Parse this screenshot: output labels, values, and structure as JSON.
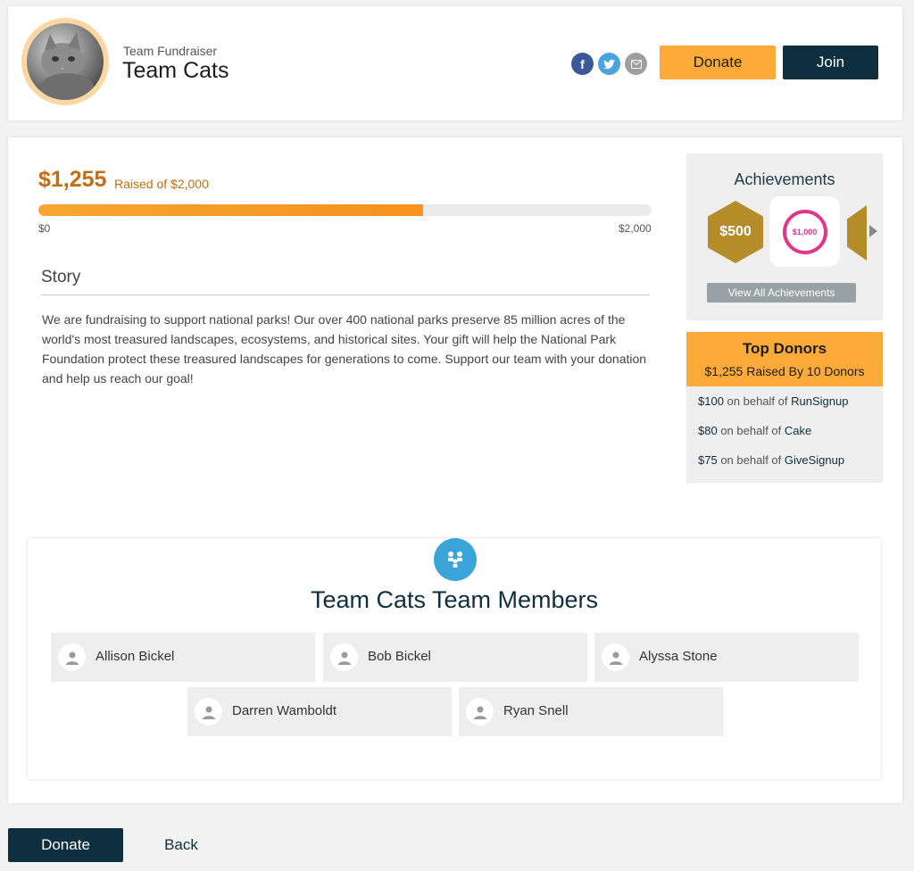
{
  "header": {
    "subtitle": "Team Fundraiser",
    "title": "Team Cats",
    "social": [
      "facebook-icon",
      "twitter-icon",
      "email-icon"
    ],
    "donate_label": "Donate",
    "join_label": "Join"
  },
  "progress": {
    "raised": "$1,255",
    "raised_of": "Raised of $2,000",
    "fraction": 0.6275,
    "min_label": "$0",
    "max_label": "$2,000"
  },
  "story": {
    "heading": "Story",
    "text": "We are fundraising to support national parks! Our over 400 national parks preserve 85 million acres of the world's most treasured landscapes, ecosystems, and historical sites. Your gift will help the National Park Foundation protect these treasured landscapes for generations to come. Support our team with your donation and help us reach our goal!"
  },
  "achievements": {
    "title": "Achievements",
    "badges": [
      "$500",
      "$1,000"
    ],
    "view_all_label": "View All Achievements"
  },
  "top_donors": {
    "title": "Top Donors",
    "subtitle": "$1,255 Raised By 10 Donors",
    "donors": [
      {
        "amount": "$100",
        "text": " on behalf of ",
        "name": "RunSignup"
      },
      {
        "amount": "$80",
        "text": " on behalf of ",
        "name": "Cake"
      },
      {
        "amount": "$75",
        "text": " on behalf of ",
        "name": "GiveSignup"
      }
    ]
  },
  "team": {
    "title": "Team Cats Team Members",
    "members": [
      "Allison Bickel",
      "Bob Bickel",
      "Alyssa Stone",
      "Darren Wamboldt",
      "Ryan Snell"
    ]
  },
  "footer": {
    "donate_label": "Donate",
    "back_label": "Back"
  },
  "colors": {
    "accent_orange": "#fcaa3a",
    "dark_navy": "#0e2f3f",
    "raised_text": "#c56d10",
    "team_icon_blue": "#3ba4d8"
  }
}
